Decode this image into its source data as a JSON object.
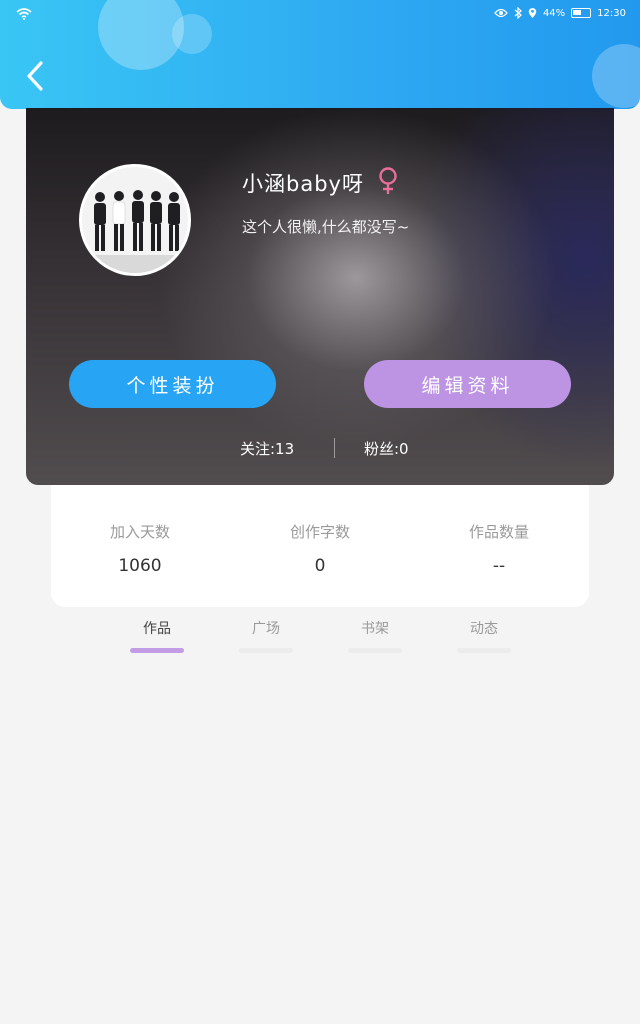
{
  "status_bar": {
    "battery": "44%",
    "time": "12:30",
    "icons": [
      "wifi-icon",
      "eye-icon",
      "bluetooth-icon",
      "location-icon",
      "battery-icon"
    ]
  },
  "header": {
    "back_icon": "chevron-left-icon"
  },
  "profile": {
    "username": "小涵baby呀",
    "gender_icon": "female-icon",
    "bio": "这个人很懒,什么都没写~",
    "dress_button": "个性装扮",
    "edit_button": "编辑资料",
    "following": "关注:13",
    "fans": "粉丝:0"
  },
  "stats": [
    {
      "label": "加入天数",
      "value": "1060"
    },
    {
      "label": "创作字数",
      "value": "0"
    },
    {
      "label": "作品数量",
      "value": "--"
    }
  ],
  "tabs": [
    {
      "label": "作品",
      "active": true
    },
    {
      "label": "广场",
      "active": false
    },
    {
      "label": "书架",
      "active": false
    },
    {
      "label": "动态",
      "active": false
    }
  ],
  "colors": {
    "header_blue": "#2ea8f2",
    "dress_button": "#27a4f4",
    "edit_button": "#bd93e3",
    "active_tab_indicator": "#c39ce6",
    "female_icon": "#e86f9a"
  }
}
